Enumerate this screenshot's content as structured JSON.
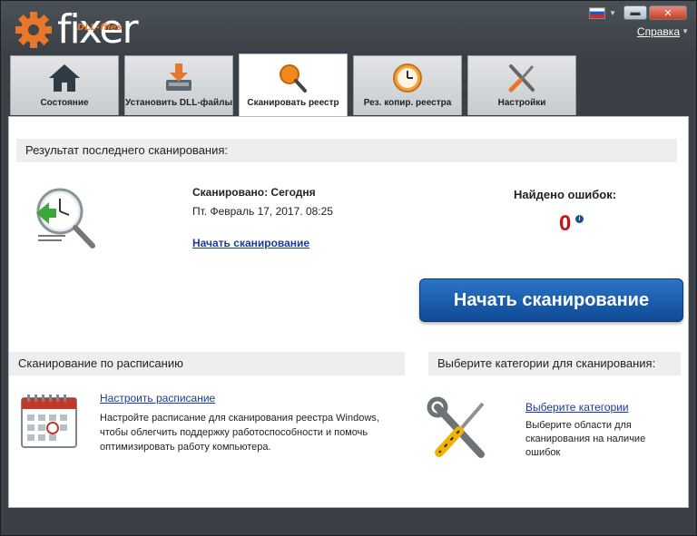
{
  "app": {
    "logo_small": "DLL-files",
    "logo_main": "fixer",
    "help_label": "Справка"
  },
  "tabs": [
    {
      "label": "Состояние",
      "icon": "home-icon"
    },
    {
      "label": "Установить DLL-файлы",
      "icon": "download-icon"
    },
    {
      "label": "Сканировать реестр",
      "icon": "magnifier-icon",
      "active": true
    },
    {
      "label": "Рез. копир. реестра",
      "icon": "clock-backup-icon"
    },
    {
      "label": "Настройки",
      "icon": "tools-icon"
    }
  ],
  "last_scan": {
    "header": "Результат последнего сканирования:",
    "scanned_label": "Сканировано: Сегодня",
    "date": "Пт. Февраль 17, 2017. 08:25",
    "link": "Начать сканирование",
    "errors_label": "Найдено ошибок:",
    "errors_count": "0"
  },
  "scan_button": "Начать сканирование",
  "schedule": {
    "header": "Сканирование по расписанию",
    "link": "Настроить расписание",
    "description": "Настройте расписание для сканирования реестра Windows, чтобы облегчить поддержку работоспособности и помочь оптимизировать работу компьютера."
  },
  "categories": {
    "header": "Выберите категории для сканирования:",
    "link": "Выберите категории",
    "description": "Выберите области для сканирования на наличие ошибок"
  },
  "colors": {
    "accent_orange": "#e8762b",
    "button_blue": "#1a5cae",
    "error_red": "#cc1111",
    "link_blue": "#1a3a9a"
  }
}
